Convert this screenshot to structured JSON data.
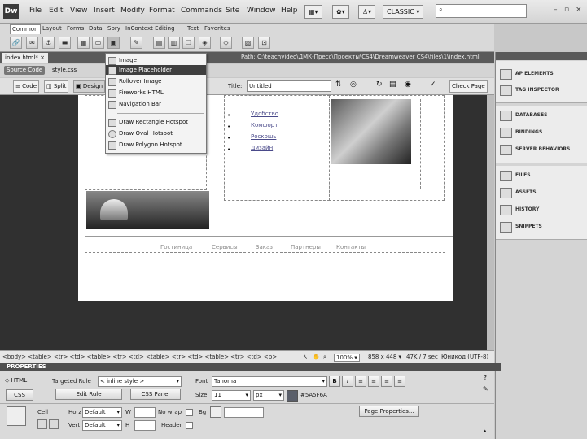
{
  "app": {
    "logo": "Dw"
  },
  "menu": [
    "File",
    "Edit",
    "View",
    "Insert",
    "Modify",
    "Format",
    "Commands",
    "Site",
    "Window",
    "Help"
  ],
  "workspace": {
    "label": "CLASSIC"
  },
  "window_controls": [
    "–",
    "▫",
    "×"
  ],
  "insert_bar": {
    "tabs": [
      "Common",
      "Layout",
      "Forms",
      "Data",
      "Spry",
      "InContext Editing",
      "Text",
      "Favorites"
    ]
  },
  "document": {
    "tab": "index.html*",
    "close": "×",
    "path": "Path: C:\\teachvideo\\ДМК-Пресс\\Проекты\\CS4\\Dreamweaver CS4\\files\\1\\index.html",
    "source_code": "Source Code",
    "related_file": "style.css",
    "view_buttons": {
      "code": "Code",
      "split": "Split",
      "design": "Design"
    },
    "title_label": "Title:",
    "title_value": "Untitled",
    "check_page": "Check Page"
  },
  "dropdown": {
    "items": [
      {
        "label": "Image"
      },
      {
        "label": "Image Placeholder"
      },
      {
        "label": "Rollover Image"
      },
      {
        "label": "Fireworks HTML"
      },
      {
        "label": "Navigation Bar"
      },
      {
        "label": "Draw Rectangle Hotspot"
      },
      {
        "label": "Draw Oval Hotspot"
      },
      {
        "label": "Draw Polygon Hotspot"
      }
    ]
  },
  "page_content": {
    "links": [
      "Удобство",
      "Комфорт",
      "Роскошь",
      "Дизайн"
    ],
    "footer_nav": [
      "Гостиница",
      "Сервисы",
      "Заказ",
      "Партнеры",
      "Контакты"
    ]
  },
  "right_panel": {
    "group1": [
      "AP ELEMENTS",
      "TAG INSPECTOR"
    ],
    "group2": [
      "DATABASES",
      "BINDINGS",
      "SERVER BEHAVIORS"
    ],
    "group3": [
      "FILES",
      "ASSETS",
      "HISTORY",
      "SNIPPETS"
    ]
  },
  "status": {
    "tags": "<body> <table> <tr> <td> <table> <tr> <td> <table> <tr> <td> <table> <tr> <td> <p>",
    "zoom": "100%",
    "size": "858 x 448",
    "weight": "47K / 7 sec",
    "encoding": "Юникод (UTF-8)"
  },
  "properties": {
    "header": "PROPERTIES",
    "html_btn": "HTML",
    "css_btn": "CSS",
    "targeted_rule_label": "Targeted Rule",
    "targeted_rule_value": "< inline style >",
    "edit_rule": "Edit Rule",
    "css_panel": "CSS Panel",
    "font_label": "Font",
    "font_value": "Tahoma",
    "size_label": "Size",
    "size_value": "11",
    "unit_value": "px",
    "color_value": "#5A5F6A",
    "bold": "B",
    "italic": "I",
    "cell_label": "Cell",
    "horz_label": "Horz",
    "horz_value": "Default",
    "vert_label": "Vert",
    "vert_value": "Default",
    "w_label": "W",
    "h_label": "H",
    "nowrap_label": "No wrap",
    "header_label": "Header",
    "bg_label": "Bg",
    "page_properties": "Page Properties..."
  },
  "colors": {
    "swatch": "#5A5F6A",
    "selection": "#3e3e3e"
  }
}
